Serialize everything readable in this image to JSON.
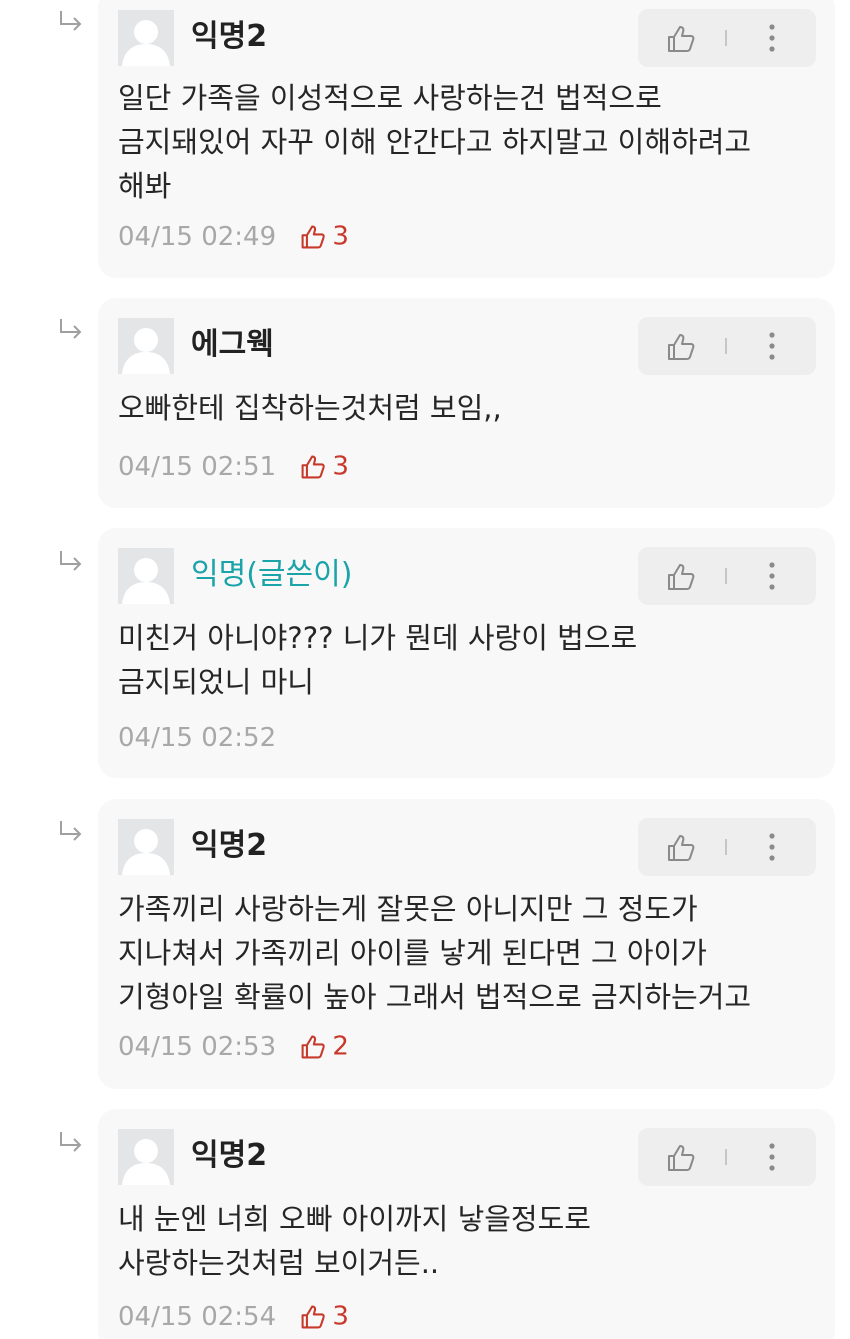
{
  "comments": [
    {
      "author": "익명2",
      "is_writer": false,
      "lines": [
        "일단 가족을 이성적으로 사랑하는건 법적으로",
        "금지돼있어 자꾸 이해 안간다고 하지말고 이해하려고",
        "해봐"
      ],
      "time": "04/15 02:49",
      "likes": "3"
    },
    {
      "author": "에그웩",
      "is_writer": false,
      "lines": [
        "오빠한테 집착하는것처럼 보임,,"
      ],
      "time": "04/15 02:51",
      "likes": "3"
    },
    {
      "author": "익명(글쓴이)",
      "is_writer": true,
      "lines": [
        "미친거 아니야??? 니가 뭔데 사랑이 법으로",
        "금지되었니 마니"
      ],
      "time": "04/15 02:52",
      "likes": ""
    },
    {
      "author": "익명2",
      "is_writer": false,
      "lines": [
        "가족끼리 사랑하는게 잘못은 아니지만 그 정도가",
        "지나쳐서 가족끼리 아이를 낳게 된다면 그 아이가",
        "기형아일 확률이 높아 그래서 법적으로 금지하는거고"
      ],
      "time": "04/15 02:53",
      "likes": "2"
    },
    {
      "author": "익명2",
      "is_writer": false,
      "lines": [
        "내 눈엔 너희 오빠 아이까지 낳을정도로",
        "사랑하는것처럼 보이거든.."
      ],
      "time": "04/15 02:54",
      "likes": "3"
    }
  ],
  "icons": {
    "reply": "reply-arrow-icon",
    "avatar": "default-avatar-icon",
    "like": "thumbs-up-icon",
    "more": "more-vertical-icon"
  },
  "colors": {
    "writer_nick": "#1aa3a8",
    "like_count": "#c73a2b",
    "meta_text": "#a8a8a8",
    "bubble_bg": "#f8f8f8"
  }
}
